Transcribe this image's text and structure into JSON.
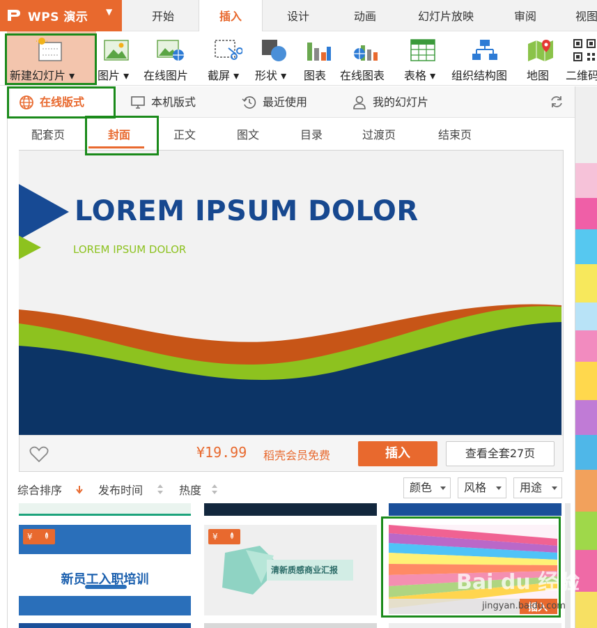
{
  "app": {
    "title": "WPS 演示"
  },
  "tabs": [
    {
      "label": "开始"
    },
    {
      "label": "插入"
    },
    {
      "label": "设计"
    },
    {
      "label": "动画"
    },
    {
      "label": "幻灯片放映"
    },
    {
      "label": "审阅"
    },
    {
      "label": "视图"
    }
  ],
  "active_tab": "插入",
  "ribbon": {
    "new_slide": "新建幻灯片",
    "picture": "图片",
    "online_picture": "在线图片",
    "screenshot": "截屏",
    "shape": "形状",
    "chart": "图表",
    "online_chart": "在线图表",
    "table": "表格",
    "org_chart": "组织结构图",
    "map": "地图",
    "qrcode": "二维码"
  },
  "source_tabs": [
    {
      "label": "在线版式"
    },
    {
      "label": "本机版式"
    },
    {
      "label": "最近使用"
    },
    {
      "label": "我的幻灯片"
    }
  ],
  "categories": [
    {
      "label": "配套页"
    },
    {
      "label": "封面"
    },
    {
      "label": "正文"
    },
    {
      "label": "图文"
    },
    {
      "label": "目录"
    },
    {
      "label": "过渡页"
    },
    {
      "label": "结束页"
    }
  ],
  "preview": {
    "title": "LOREM IPSUM DOLOR",
    "subtitle": "LOREM IPSUM DOLOR",
    "price": "¥19.99",
    "member_free": "稻壳会员免费",
    "insert_label": "插入",
    "view_all_label": "查看全套27页"
  },
  "sort": {
    "overall": "综合排序",
    "publish_time": "发布时间",
    "popularity": "热度",
    "color": "颜色",
    "style": "风格",
    "usage": "用途"
  },
  "thumbnails": [
    {
      "title": "新员工入职培训",
      "badge": "¥"
    },
    {
      "title": "清新质感商业汇报",
      "badge": "¥"
    },
    {
      "title": "",
      "insert_label": "插入"
    }
  ],
  "watermark": {
    "text": "Bai du 经验",
    "url": "jingyan.baidu.com"
  },
  "colors": {
    "accent": "#e8692e",
    "highlight": "#1a8a1a",
    "title_blue": "#17488f",
    "green": "#8dc21f"
  }
}
